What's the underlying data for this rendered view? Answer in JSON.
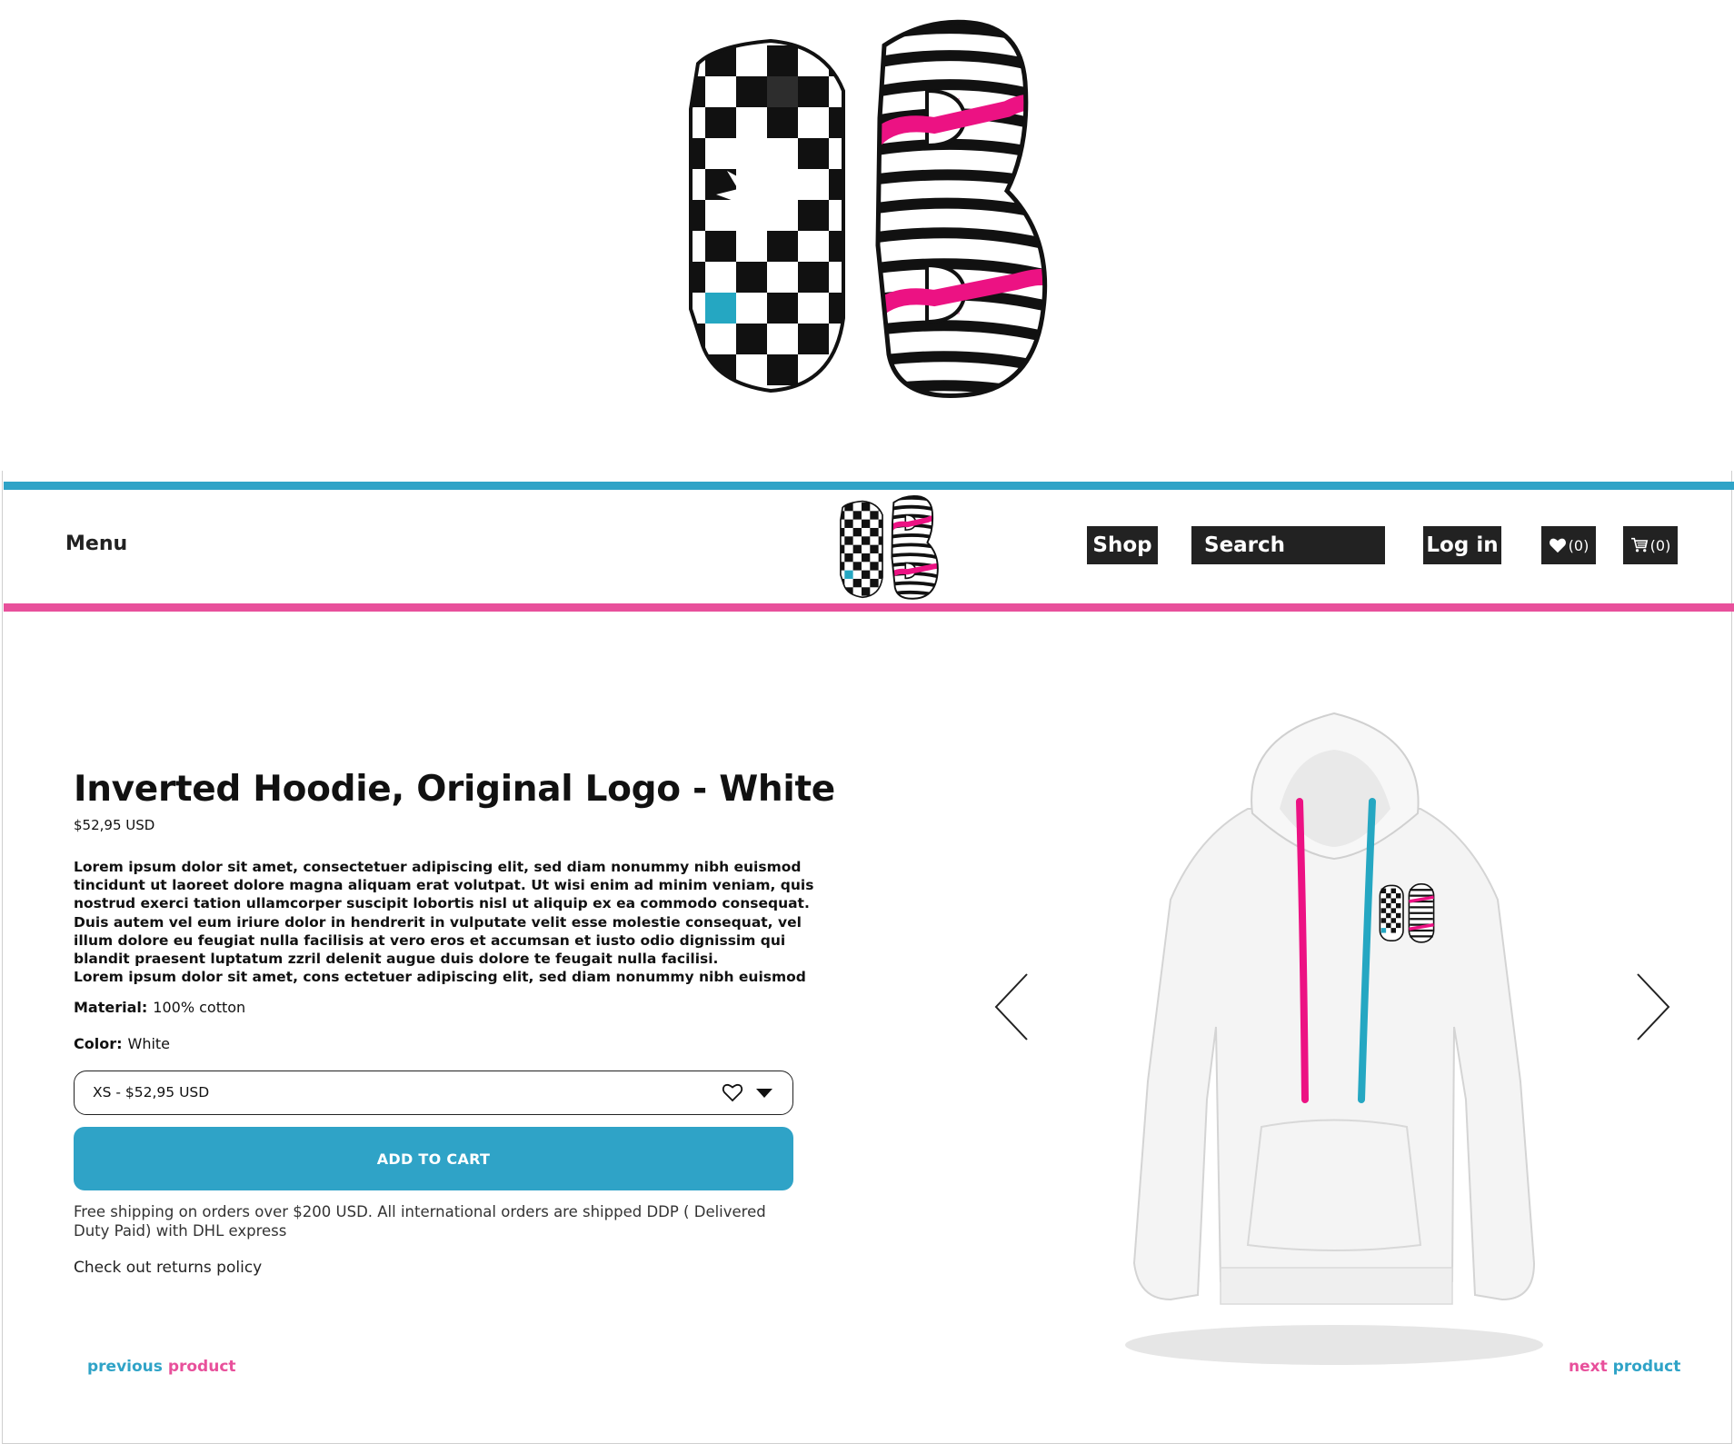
{
  "brand": {
    "accent_blue": "#2fa3c7",
    "accent_pink": "#e8509b",
    "dark": "#222222"
  },
  "header": {
    "menu_label": "Menu",
    "shop_label": "Shop",
    "search_label": "Search",
    "login_label": "Log in",
    "wishlist_count": "(0)",
    "cart_count": "(0)",
    "icons": [
      "heart-icon",
      "cart-icon"
    ]
  },
  "product": {
    "title": "Inverted Hoodie, Original Logo - White",
    "price": "$52,95 USD",
    "description_1": "Lorem ipsum dolor sit amet, consectetuer adipiscing elit, sed diam nonummy nibh euismod tincidunt ut laoreet dolore magna aliquam erat volutpat. Ut wisi enim ad minim veniam, quis nostrud exerci tation ullamcorper suscipit lobortis nisl ut aliquip ex ea commodo consequat. Duis autem vel eum iriure dolor in hendrerit in vulputate velit esse molestie consequat, vel illum dolore eu feugiat nulla facilisis at vero eros et accumsan et iusto odio dignissim qui blandit praesent luptatum zzril delenit augue duis dolore te feugait nulla facilisi.",
    "description_2": "Lorem ipsum dolor sit amet, cons ectetuer adipiscing elit, sed diam nonummy nibh euismod",
    "material_label": "Material:",
    "material_value": "100% cotton",
    "color_label": "Color:",
    "color_value": "White",
    "variant_selected": "XS - $52,95 USD",
    "add_to_cart": "ADD TO CART",
    "shipping_note": "Free shipping on orders over $200 USD. All international orders are shipped DDP ( Delivered Duty Paid) with DHL express",
    "returns_link": "Check out returns policy"
  },
  "pager": {
    "prev_a": "previous",
    "prev_b": " product",
    "next_a": "next",
    "next_b": " product"
  }
}
